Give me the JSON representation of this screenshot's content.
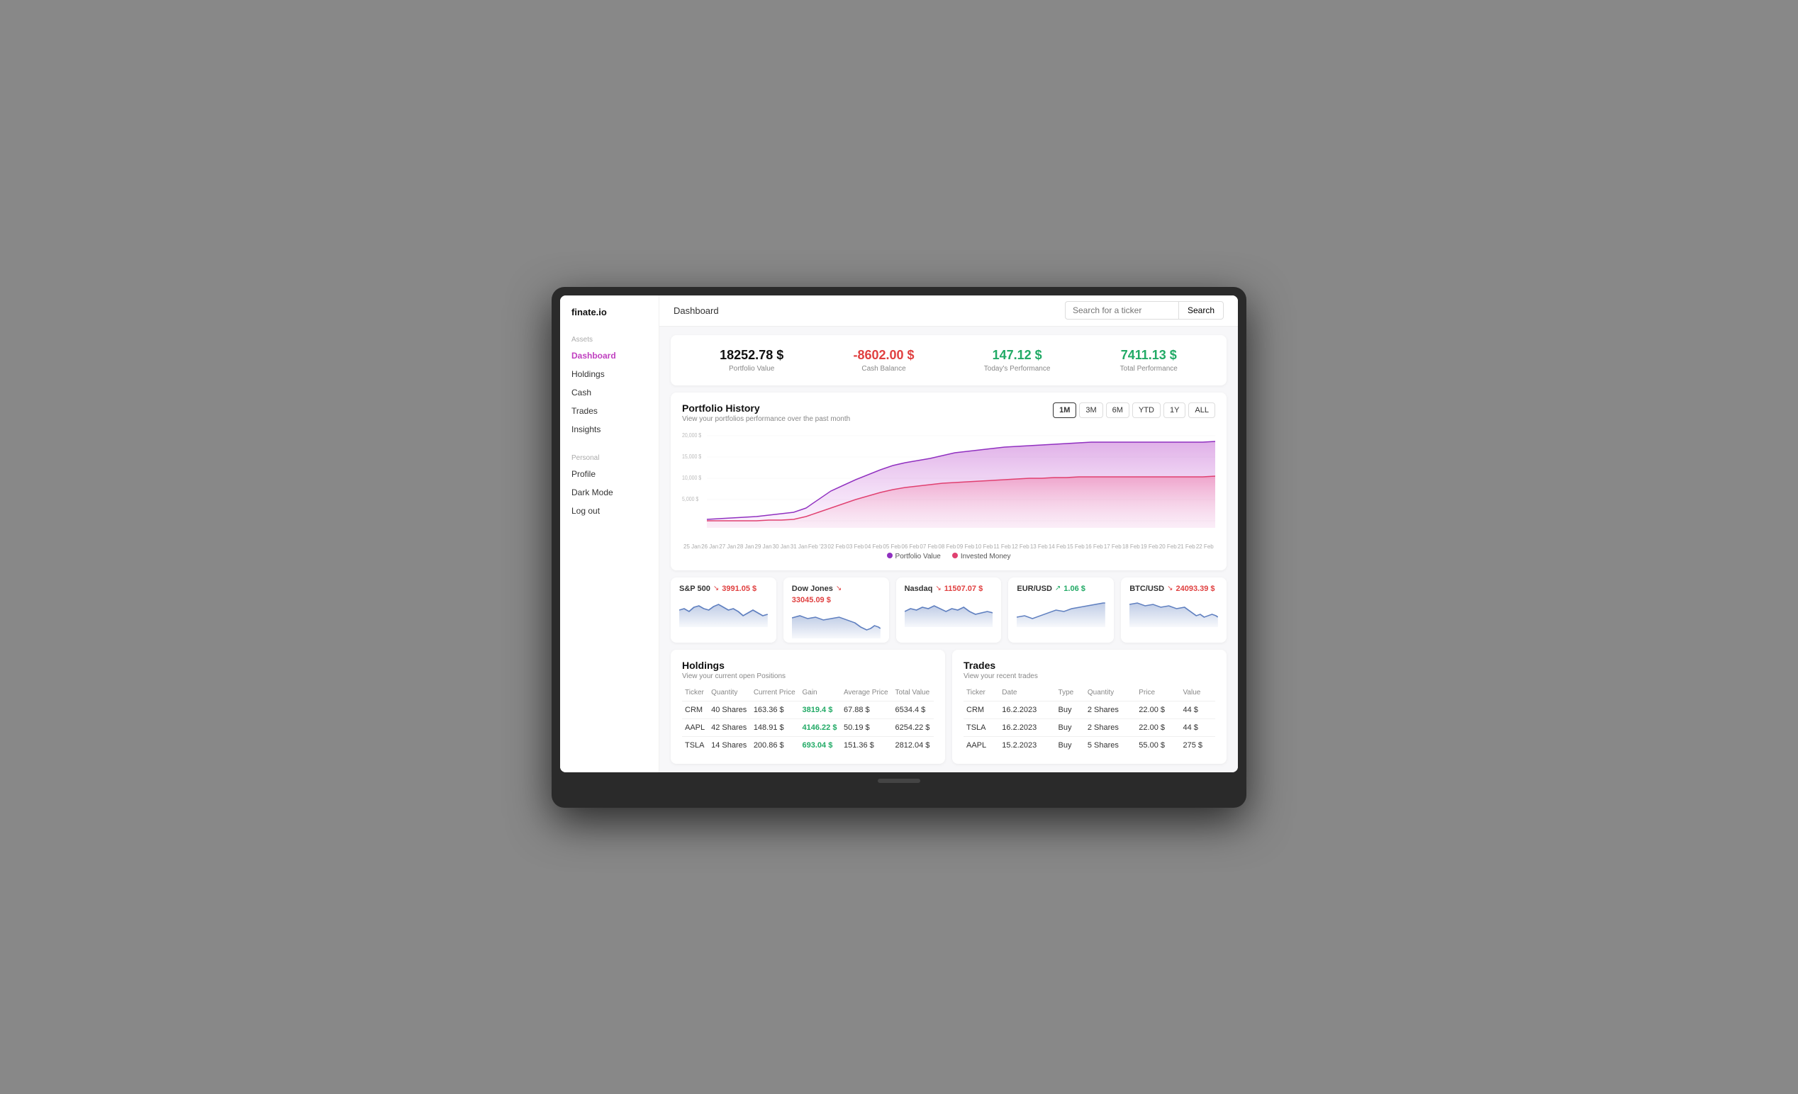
{
  "app": {
    "logo": "finate.io",
    "title": "Dashboard"
  },
  "search": {
    "placeholder": "Search for a ticker",
    "button_label": "Search"
  },
  "stats": [
    {
      "value": "18252.78 $",
      "label": "Portfolio Value",
      "type": "normal"
    },
    {
      "value": "-8602.00 $",
      "label": "Cash Balance",
      "type": "negative"
    },
    {
      "value": "147.12 $",
      "label": "Today's Performance",
      "type": "positive"
    },
    {
      "value": "7411.13 $",
      "label": "Total Performance",
      "type": "positive"
    }
  ],
  "portfolio_history": {
    "title": "Portfolio History",
    "subtitle": "View your portfolios performance over the past month",
    "buttons": [
      "1M",
      "3M",
      "6M",
      "YTD",
      "1Y",
      "ALL"
    ],
    "active_button": "1M",
    "legend": [
      "Portfolio Value",
      "Invested Money"
    ],
    "y_labels": [
      "20,000 $",
      "15,000 $",
      "10,000 $",
      "5,000 $",
      ""
    ],
    "x_labels": [
      "25 Jan",
      "26 Jan",
      "27 Jan",
      "28 Jan",
      "29 Jan",
      "30 Jan",
      "31 Jan",
      "Feb '23",
      "02 Feb",
      "03 Feb",
      "04 Feb",
      "05 Feb",
      "06 Feb",
      "07 Feb",
      "08 Feb",
      "09 Feb",
      "10 Feb",
      "11 Feb",
      "12 Feb",
      "13 Feb",
      "14 Feb",
      "15 Feb",
      "16 Feb",
      "17 Feb",
      "18 Feb",
      "19 Feb",
      "20 Feb",
      "21 Feb",
      "22 Feb"
    ]
  },
  "sidebar": {
    "assets_label": "Assets",
    "personal_label": "Personal",
    "items_assets": [
      {
        "label": "Dashboard",
        "active": true,
        "id": "dashboard"
      },
      {
        "label": "Holdings",
        "active": false,
        "id": "holdings"
      },
      {
        "label": "Cash",
        "active": false,
        "id": "cash"
      },
      {
        "label": "Trades",
        "active": false,
        "id": "trades"
      },
      {
        "label": "Insights",
        "active": false,
        "id": "insights"
      }
    ],
    "items_personal": [
      {
        "label": "Profile",
        "active": false,
        "id": "profile"
      },
      {
        "label": "Dark Mode",
        "active": false,
        "id": "dark-mode"
      },
      {
        "label": "Log out",
        "active": false,
        "id": "logout"
      }
    ]
  },
  "tickers": [
    {
      "name": "S&P 500",
      "direction": "down",
      "value": "3991.05 $",
      "arrow": "↘"
    },
    {
      "name": "Dow Jones",
      "direction": "down",
      "value": "33045.09 $",
      "arrow": "↘"
    },
    {
      "name": "Nasdaq",
      "direction": "down",
      "value": "11507.07 $",
      "arrow": "↘"
    },
    {
      "name": "EUR/USD",
      "direction": "up",
      "value": "1.06 $",
      "arrow": "↗"
    },
    {
      "name": "BTC/USD",
      "direction": "down",
      "value": "24093.39 $",
      "arrow": "↘"
    }
  ],
  "holdings": {
    "title": "Holdings",
    "subtitle": "View your current open Positions",
    "columns": [
      "Ticker",
      "Quantity",
      "Current Price",
      "Gain",
      "Average Price",
      "Total Value"
    ],
    "rows": [
      {
        "ticker": "CRM",
        "quantity": "40 Shares",
        "price": "163.36 $",
        "gain": "3819.4 $",
        "avg": "67.88 $",
        "total": "6534.4 $",
        "gain_pos": true
      },
      {
        "ticker": "AAPL",
        "quantity": "42 Shares",
        "price": "148.91 $",
        "gain": "4146.22 $",
        "avg": "50.19 $",
        "total": "6254.22 $",
        "gain_pos": true
      },
      {
        "ticker": "TSLA",
        "quantity": "14 Shares",
        "price": "200.86 $",
        "gain": "693.04 $",
        "avg": "151.36 $",
        "total": "2812.04 $",
        "gain_pos": true
      }
    ]
  },
  "trades": {
    "title": "Trades",
    "subtitle": "View your recent trades",
    "columns": [
      "Ticker",
      "Date",
      "Type",
      "Quantity",
      "Price",
      "Value"
    ],
    "rows": [
      {
        "ticker": "CRM",
        "date": "16.2.2023",
        "type": "Buy",
        "quantity": "2 Shares",
        "price": "22.00 $",
        "value": "44 $"
      },
      {
        "ticker": "TSLA",
        "date": "16.2.2023",
        "type": "Buy",
        "quantity": "2 Shares",
        "price": "22.00 $",
        "value": "44 $"
      },
      {
        "ticker": "AAPL",
        "date": "15.2.2023",
        "type": "Buy",
        "quantity": "5 Shares",
        "price": "55.00 $",
        "value": "275 $"
      }
    ]
  }
}
